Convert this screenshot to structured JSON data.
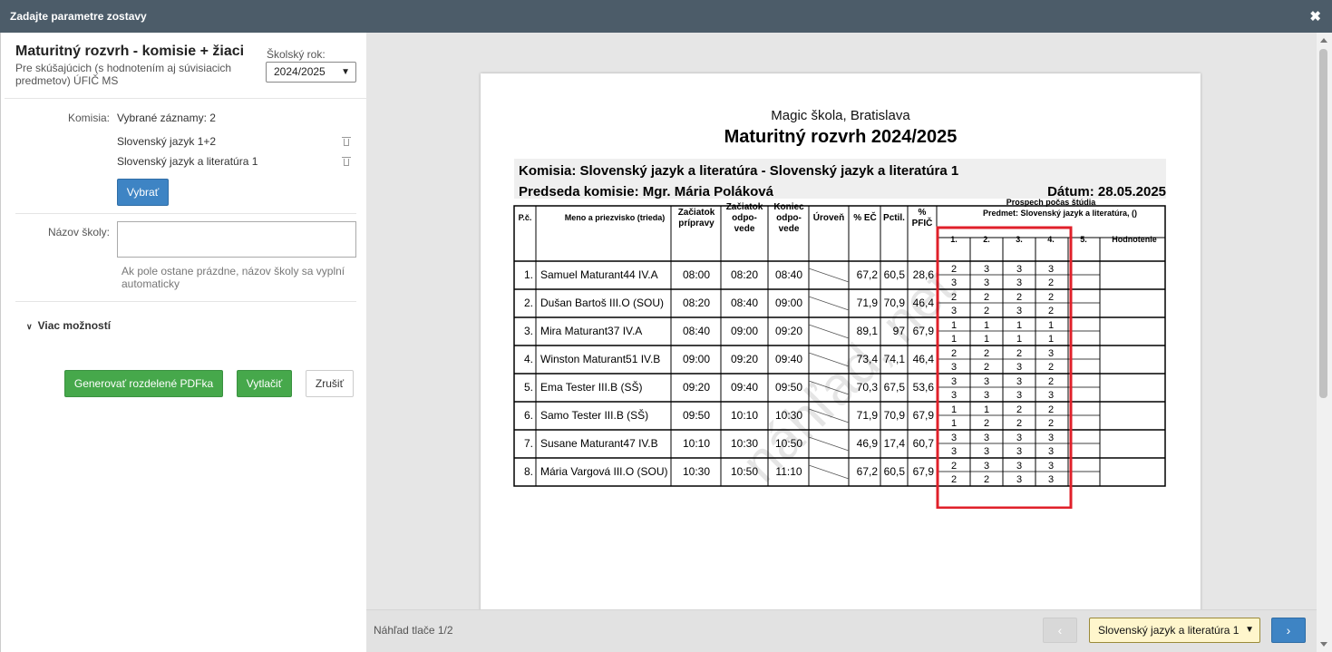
{
  "dialog": {
    "title": "Zadajte parametre zostavy",
    "close_glyph": "✖"
  },
  "report": {
    "title": "Maturitný rozvrh - komisie + žiaci",
    "subtitle": "Pre skúšajúcich (s hodnotením aj súvisiacich predmetov) ÚFIČ MS",
    "year_label": "Školský rok:",
    "year_value": "2024/2025"
  },
  "form": {
    "komisia_label": "Komisia:",
    "komisia_value": "Vybrané záznamy: 2",
    "komisia_items": [
      "Slovenský jazyk 1+2",
      "Slovenský jazyk a literatúra 1"
    ],
    "vybrat_label": "Vybrať",
    "nazov_label": "Názov školy:",
    "nazov_value": "",
    "nazov_hint": "Ak pole ostane prázdne, názov školy sa vyplní automaticky",
    "viac_label": "Viac možností",
    "gen_label": "Generovať rozdelené PDFka",
    "print_label": "Vytlačiť",
    "cancel_label": "Zrušiť"
  },
  "doc": {
    "school": "Magic škola, Bratislava",
    "title": "Maturitný rozvrh 2024/2025",
    "komisia": "Komisia: Slovenský jazyk a literatúra - Slovenský jazyk a literatúra 1",
    "predseda": "Predseda komisie: Mgr. Mária Poláková",
    "datum": "Dátum: 28.05.2025",
    "watermark": "náhľad, net"
  },
  "table": {
    "headers": {
      "pc": "P.č.",
      "meno": "Meno a priezvisko (trieda)",
      "zp1": "Začiatok",
      "zp2": "prípravy",
      "zo1": "Začiatok",
      "zo2": "odpo-",
      "zo3": "vede",
      "ko1": "Koniec",
      "ko2": "odpo-",
      "ko3": "vede",
      "uroven": "Úroveň",
      "ec": "% EČ",
      "pctil": "Pctil.",
      "pfic1": "%",
      "pfic2": "PFIČ",
      "prospech1": "Prospech počas štúdia",
      "prospech2": "Predmet:  Slovenský jazyk a literatúra, ()",
      "y1": "1.",
      "y2": "2.",
      "y3": "3.",
      "y4": "4.",
      "y5": "5.",
      "hodnotenie": "Hodnotenie"
    },
    "rows": [
      {
        "n": "1.",
        "name": "Samuel Maturant44  IV.A",
        "zp": "08:00",
        "zo": "08:20",
        "ko": "08:40",
        "ec": "67,2",
        "pctil": "60,5",
        "pfic": "28,6",
        "g1": [
          "2",
          "3",
          "3",
          "3"
        ],
        "g2": [
          "3",
          "3",
          "3",
          "2"
        ]
      },
      {
        "n": "2.",
        "name": "Dušan Bartoš  III.O (SOU)",
        "zp": "08:20",
        "zo": "08:40",
        "ko": "09:00",
        "ec": "71,9",
        "pctil": "70,9",
        "pfic": "46,4",
        "g1": [
          "2",
          "2",
          "2",
          "2"
        ],
        "g2": [
          "3",
          "2",
          "3",
          "2"
        ]
      },
      {
        "n": "3.",
        "name": "Mira Maturant37  IV.A",
        "zp": "08:40",
        "zo": "09:00",
        "ko": "09:20",
        "ec": "89,1",
        "pctil": "97",
        "pfic": "67,9",
        "g1": [
          "1",
          "1",
          "1",
          "1"
        ],
        "g2": [
          "1",
          "1",
          "1",
          "1"
        ]
      },
      {
        "n": "4.",
        "name": "Winston Maturant51  IV.B",
        "zp": "09:00",
        "zo": "09:20",
        "ko": "09:40",
        "ec": "73,4",
        "pctil": "74,1",
        "pfic": "46,4",
        "g1": [
          "2",
          "2",
          "2",
          "3"
        ],
        "g2": [
          "3",
          "2",
          "3",
          "2"
        ]
      },
      {
        "n": "5.",
        "name": "Ema Tester  III.B (SŠ)",
        "zp": "09:20",
        "zo": "09:40",
        "ko": "09:50",
        "ec": "70,3",
        "pctil": "67,5",
        "pfic": "53,6",
        "g1": [
          "3",
          "3",
          "3",
          "2"
        ],
        "g2": [
          "3",
          "3",
          "3",
          "3"
        ]
      },
      {
        "n": "6.",
        "name": "Samo Tester  III.B (SŠ)",
        "zp": "09:50",
        "zo": "10:10",
        "ko": "10:30",
        "ec": "71,9",
        "pctil": "70,9",
        "pfic": "67,9",
        "g1": [
          "1",
          "1",
          "2",
          "2"
        ],
        "g2": [
          "1",
          "2",
          "2",
          "2"
        ]
      },
      {
        "n": "7.",
        "name": "Susane Maturant47  IV.B",
        "zp": "10:10",
        "zo": "10:30",
        "ko": "10:50",
        "ec": "46,9",
        "pctil": "17,4",
        "pfic": "60,7",
        "g1": [
          "3",
          "3",
          "3",
          "3"
        ],
        "g2": [
          "3",
          "3",
          "3",
          "3"
        ]
      },
      {
        "n": "8.",
        "name": "Mária Vargová  III.O (SOU)",
        "zp": "10:30",
        "zo": "10:50",
        "ko": "11:10",
        "ec": "67,2",
        "pctil": "60,5",
        "pfic": "67,9",
        "g1": [
          "2",
          "3",
          "3",
          "3"
        ],
        "g2": [
          "2",
          "2",
          "3",
          "3"
        ]
      }
    ]
  },
  "footer": {
    "page_label": "Náhľad tlače 1/2",
    "select_value": "Slovenský jazyk a literatúra 1",
    "prev_glyph": "‹",
    "next_glyph": "›"
  },
  "colors": {
    "titlebar": "#4c5c69",
    "highlight": "#e0202a",
    "blue": "#3e84c4",
    "green": "#46a84b"
  }
}
